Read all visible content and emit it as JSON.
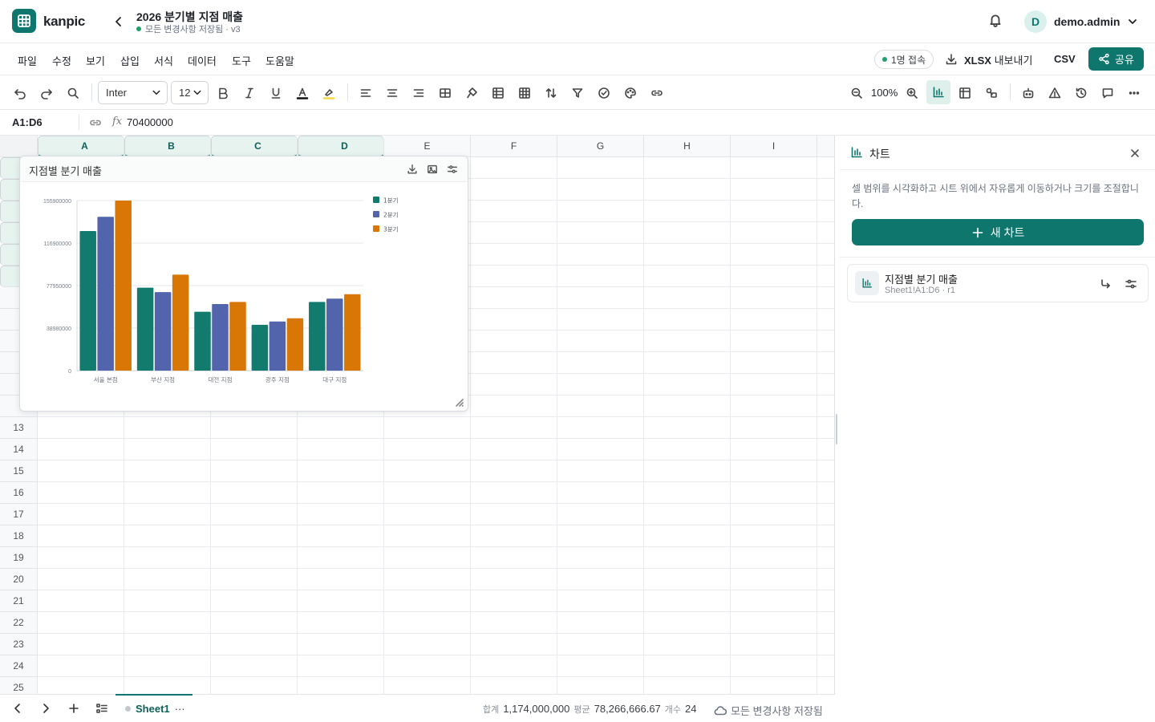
{
  "app": {
    "brand": "kanpic"
  },
  "document": {
    "title": "2026 분기별 지점 매출",
    "status": "모든 변경사항 저장됨 · v3"
  },
  "user": {
    "initial": "D",
    "name": "demo.admin"
  },
  "menu": [
    "파일",
    "수정",
    "보기",
    "삽입",
    "서식",
    "데이터",
    "도구",
    "도움말"
  ],
  "header_actions": {
    "presence": "1명 접속",
    "xlsx_bold": "XLSX",
    "xlsx_rest": "내보내기",
    "csv": "CSV",
    "share": "공유"
  },
  "toolbar": {
    "font": "Inter",
    "font_size": "12",
    "zoom": "100%"
  },
  "formula": {
    "cell_ref": "A1:D6",
    "fx": "fx",
    "value": "70400000"
  },
  "grid": {
    "columns": [
      "A",
      "B",
      "C",
      "D",
      "E",
      "F",
      "G",
      "H",
      "I"
    ],
    "selected_columns": [
      "A",
      "B",
      "C",
      "D"
    ],
    "visible_rows": [
      "13",
      "14",
      "15",
      "16",
      "17",
      "18",
      "19",
      "20",
      "21",
      "22",
      "23",
      "24",
      "25"
    ]
  },
  "chart_card": {
    "title": "지점별 분기 매출"
  },
  "chart_data": {
    "type": "bar",
    "categories": [
      "서울 본점",
      "부산 지점",
      "대전 지점",
      "광주 지점",
      "대구 지점"
    ],
    "series": [
      {
        "name": "1분기",
        "values": [
          128000000,
          76000000,
          54000000,
          42000000,
          63000000
        ],
        "color": "#137a6e"
      },
      {
        "name": "2분기",
        "values": [
          141000000,
          72000000,
          61000000,
          45000000,
          66000000
        ],
        "color": "#5264ac"
      },
      {
        "name": "3분기",
        "values": [
          155900000,
          88000000,
          63000000,
          48000000,
          70000000
        ],
        "color": "#d97706"
      }
    ],
    "y_ticks": [
      "155900000",
      "116900000",
      "77950000",
      "38980000",
      "0"
    ],
    "ylim": [
      0,
      155900000
    ],
    "grid": true,
    "legend": "top-right"
  },
  "panel": {
    "title": "차트",
    "description": "셀 범위를 시각화하고 시트 위에서 자유롭게 이동하거나 크기를 조절합니다.",
    "new_chart": "새 차트",
    "item": {
      "name": "지점별 분기 매출",
      "sub": "Sheet1!A1:D6 · r1"
    }
  },
  "bottom": {
    "sheet": "Sheet1",
    "more": "···",
    "sum_label": "합계",
    "sum": "1,174,000,000",
    "avg_label": "평균",
    "avg": "78,266,666.67",
    "count_label": "개수",
    "count": "24",
    "save_status": "모든 변경사항 저장됨"
  },
  "colors": {
    "accent": "#0f766e"
  }
}
